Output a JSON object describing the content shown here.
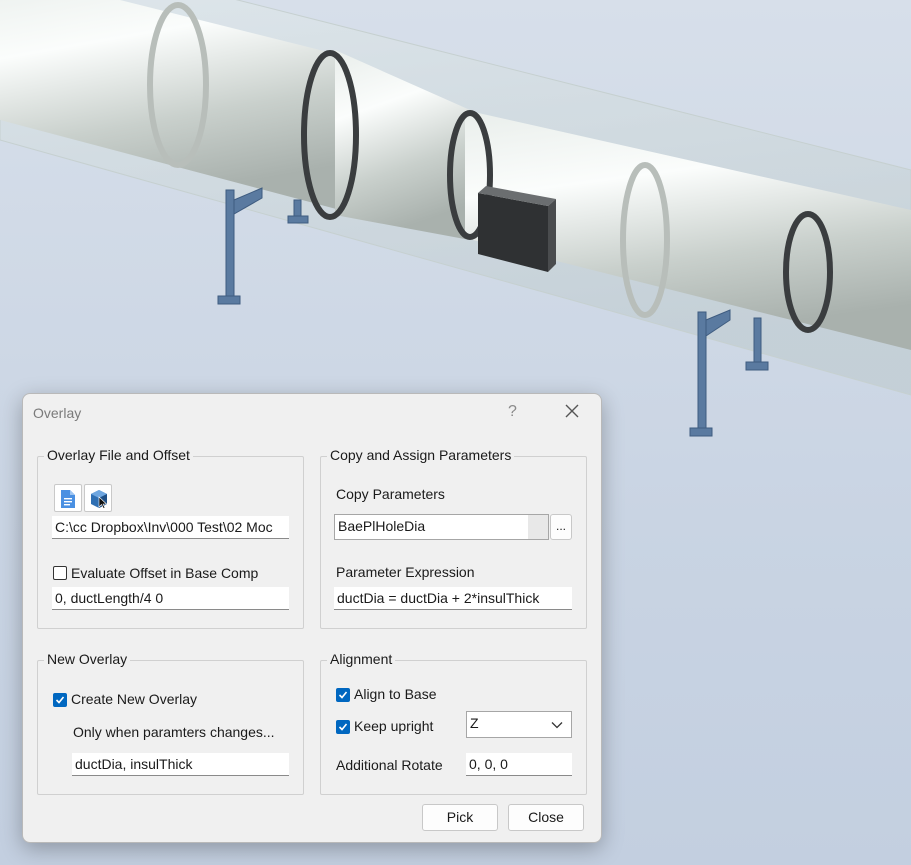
{
  "dialog": {
    "title": "Overlay",
    "help": "?"
  },
  "overlay_file": {
    "group_label": "Overlay File and Offset",
    "file_path": "C:\\cc Dropbox\\Inv\\000 Test\\02 Moc",
    "evaluate_offset_label": "Evaluate Offset in Base Comp",
    "evaluate_offset_checked": false,
    "offset_value": "0, ductLength/4 0",
    "icons": [
      "document-icon",
      "part-cube-icon"
    ]
  },
  "copy_params": {
    "group_label": "Copy and Assign Parameters",
    "copy_label": "Copy Parameters",
    "copy_value": "BaePlHoleDia",
    "browse_label": "...",
    "expression_label": "Parameter Expression",
    "expression_value": "ductDia = ductDia + 2*insulThick"
  },
  "new_overlay": {
    "group_label": "New Overlay",
    "create_label": "Create New Overlay",
    "create_checked": true,
    "only_when_label": "Only when paramters changes...",
    "params_value": "ductDia, insulThick"
  },
  "alignment": {
    "group_label": "Alignment",
    "align_label": "Align to Base",
    "align_checked": true,
    "upright_label": "Keep upright",
    "upright_checked": true,
    "axis_value": "Z",
    "rotate_label": "Additional Rotate",
    "rotate_value": "0, 0, 0"
  },
  "buttons": {
    "pick": "Pick",
    "close": "Close"
  },
  "colors": {
    "accent": "#0067c0",
    "dialog_bg": "#f0f0f0",
    "support_steel": "#5a7aa0",
    "damper_box": "#3c3e40"
  }
}
